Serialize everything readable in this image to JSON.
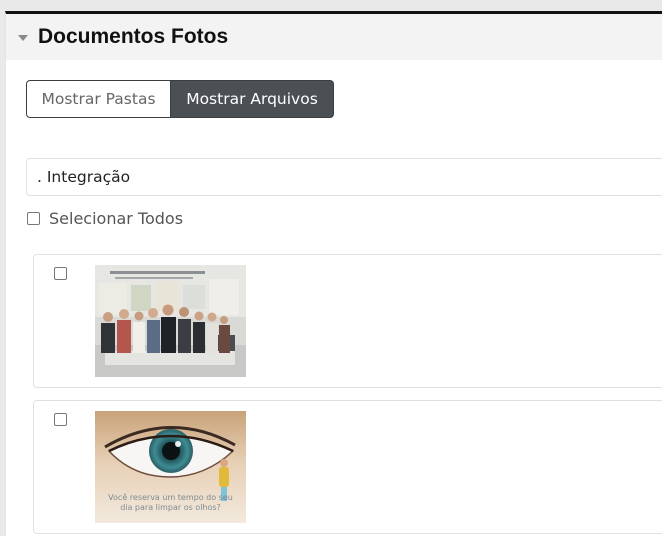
{
  "panel": {
    "title": "Documentos Fotos"
  },
  "view_toggle": {
    "folders_label": "Mostrar Pastas",
    "files_label": "Mostrar Arquivos",
    "active": "files"
  },
  "folder": {
    "path": ". Integração"
  },
  "select_all": {
    "label": "Selecionar Todos",
    "checked": false
  },
  "files": [
    {
      "checked": false,
      "thumbnail": "group-photo"
    },
    {
      "checked": false,
      "thumbnail": "eye-poster",
      "caption_line1": "Você reserva um tempo do seu",
      "caption_line2": "dia para limpar os olhos?"
    }
  ],
  "icons": {
    "collapse": "caret-down-icon",
    "checkbox": "checkbox-icon"
  },
  "colors": {
    "active_button_bg": "#4b5055",
    "header_bg": "#f3f3f3",
    "top_border": "#111111"
  }
}
